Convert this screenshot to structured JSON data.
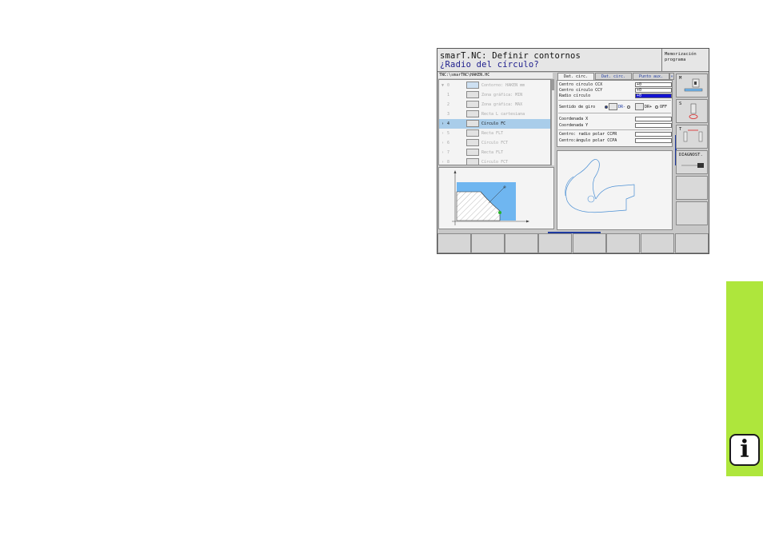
{
  "header": {
    "line1": "smarT.NC: Definir contornos",
    "line2": "¿Radio del círculo?",
    "mode": "Memorización programa"
  },
  "tree": {
    "path": "TNC:\\smarTNC\\HAKEN.HC",
    "rows": [
      {
        "arrow": "▼",
        "num": "0",
        "label": "Contorno: HAKEN mm",
        "selected": false
      },
      {
        "arrow": "",
        "num": "1",
        "label": "Zona gráfica: MIN",
        "selected": false
      },
      {
        "arrow": "",
        "num": "2",
        "label": "Zona gráfica: MAX",
        "selected": false
      },
      {
        "arrow": "",
        "num": "3",
        "label": "Recta L cartesiana",
        "selected": false
      },
      {
        "arrow": "›",
        "num": "4",
        "label": "Círculo FC",
        "selected": true
      },
      {
        "arrow": "›",
        "num": "5",
        "label": "Recta FLT",
        "selected": false
      },
      {
        "arrow": "›",
        "num": "6",
        "label": "Círculo FCT",
        "selected": false
      },
      {
        "arrow": "›",
        "num": "7",
        "label": "Recta FLT",
        "selected": false
      },
      {
        "arrow": "›",
        "num": "8",
        "label": "Círculo FCT",
        "selected": false
      }
    ]
  },
  "tabs": [
    {
      "label": "Dat. circ.",
      "active": true
    },
    {
      "label": "Dat. circ.",
      "active": false
    },
    {
      "label": "Punto aux.",
      "active": false
    }
  ],
  "tab_more": "»",
  "form": {
    "center_x_label": "Centro círculo CCX",
    "center_x_value": "+0",
    "center_y_label": "Centro círculo CCY",
    "center_y_value": "+0",
    "radius_label": "Radio círculo",
    "radius_value": "+0",
    "dir_label": "Sentido de giro",
    "dir_dr_minus": "DR-",
    "dir_dr_plus": "DR+",
    "dir_off": "OFF",
    "coord_x_label": "Coordenada X",
    "coord_y_label": "Coordenada Y",
    "polar_r_label": "Centro: radio polar CCPR",
    "polar_a_label": "Centro:ángulo polar CCPA"
  },
  "side_softkeys": {
    "m": "M",
    "s": "S",
    "t": "T",
    "diag": "DIAGNOST."
  },
  "colors": {
    "accent": "#1e3aa0",
    "selected_row": "#a9cdea",
    "active_field": "#1414d2",
    "tab_strip": "#aee63c"
  },
  "info_icon": "i"
}
